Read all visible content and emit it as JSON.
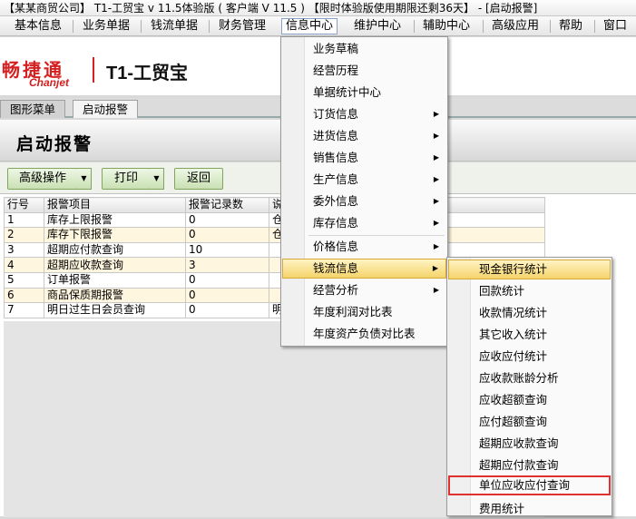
{
  "window": {
    "title": "【某某商贸公司】 T1-工贸宝 v 11.5体验版 ( 客户端 V 11.5 ) 【限时体验版使用期限还剩36天】 - [启动报警]"
  },
  "menubar": {
    "items": [
      "基本信息",
      "业务单据",
      "钱流单据",
      "财务管理",
      "信息中心",
      "维护中心",
      "辅助中心",
      "高级应用",
      "帮助",
      "窗口"
    ],
    "active": "信息中心"
  },
  "logo": {
    "cn": "畅捷通",
    "en": "Chanjet",
    "product": "T1-工贸宝"
  },
  "tabs": [
    {
      "label": "图形菜单"
    },
    {
      "label": "启动报警"
    }
  ],
  "page": {
    "title": "启动报警"
  },
  "toolbar": {
    "advanced_label": "高级操作",
    "print_label": "打印",
    "back_label": "返回"
  },
  "table": {
    "headers": [
      "行号",
      "报警项目",
      "报警记录数",
      "说"
    ],
    "rows": [
      [
        "1",
        "库存上限报警",
        "0",
        "仓"
      ],
      [
        "2",
        "库存下限报警",
        "0",
        "仓"
      ],
      [
        "3",
        "超期应付款查询",
        "10",
        ""
      ],
      [
        "4",
        "超期应收款查询",
        "3",
        ""
      ],
      [
        "5",
        "订单报警",
        "0",
        ""
      ],
      [
        "6",
        "商品保质期报警",
        "0",
        ""
      ],
      [
        "7",
        "明日过生日会员查询",
        "0",
        "明"
      ]
    ]
  },
  "dropdown": {
    "items": [
      {
        "label": "业务草稿",
        "arrow": ""
      },
      {
        "label": "经营历程",
        "arrow": ""
      },
      {
        "label": "单据统计中心",
        "arrow": ""
      },
      {
        "label": "订货信息",
        "arrow": "▶"
      },
      {
        "label": "进货信息",
        "arrow": "▶"
      },
      {
        "label": "销售信息",
        "arrow": "▶"
      },
      {
        "label": "生产信息",
        "arrow": "▶"
      },
      {
        "label": "委外信息",
        "arrow": "▶"
      },
      {
        "label": "库存信息",
        "arrow": "▶"
      },
      {
        "label": "价格信息",
        "arrow": "▶"
      },
      {
        "label": "钱流信息",
        "arrow": "▶"
      },
      {
        "label": "经营分析",
        "arrow": "▶"
      },
      {
        "label": "年度利润对比表",
        "arrow": ""
      },
      {
        "label": "年度资产负债对比表",
        "arrow": ""
      }
    ]
  },
  "submenu": {
    "items": [
      {
        "label": "现金银行统计"
      },
      {
        "label": "回款统计"
      },
      {
        "label": "收款情况统计"
      },
      {
        "label": "其它收入统计"
      },
      {
        "label": "应收应付统计"
      },
      {
        "label": "应收款账龄分析"
      },
      {
        "label": "应收超额查询"
      },
      {
        "label": "应付超额查询"
      },
      {
        "label": "超期应收款查询"
      },
      {
        "label": "超期应付款查询"
      },
      {
        "label": "单位应收应付查询"
      },
      {
        "label": "费用统计"
      }
    ]
  }
}
